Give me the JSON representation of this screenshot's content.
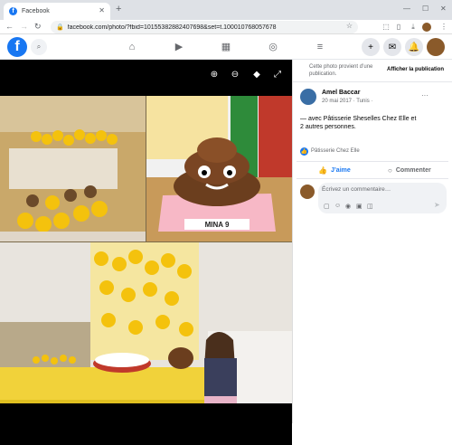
{
  "browser": {
    "tab_title": "Facebook",
    "tab_favicon": "f",
    "url": "facebook.com/photo/?fbid=10155382882407698&set=t.100010768057678"
  },
  "photo_overlay": {
    "cake_label": "MINA 9"
  },
  "sidebar": {
    "share_info": "Cette photo provient d’une publication.",
    "show_post_label": "Afficher la publication",
    "author_name": "Amel Baccar",
    "post_meta": "20 mai 2017 · Tunis ·",
    "more_label": "···",
    "post_text_line1": "— avec Pâtisserie Sheselles Chez Elle et",
    "post_text_line2": "2 autres personnes.",
    "reaction_name": "Pâtisserie Chez Elle",
    "like_label": "J’aime",
    "comment_label": "Commenter",
    "comment_placeholder": "Écrivez un commentaire…"
  },
  "colors": {
    "facebook_blue": "#1877f2",
    "like_blue": "#1877f2"
  }
}
